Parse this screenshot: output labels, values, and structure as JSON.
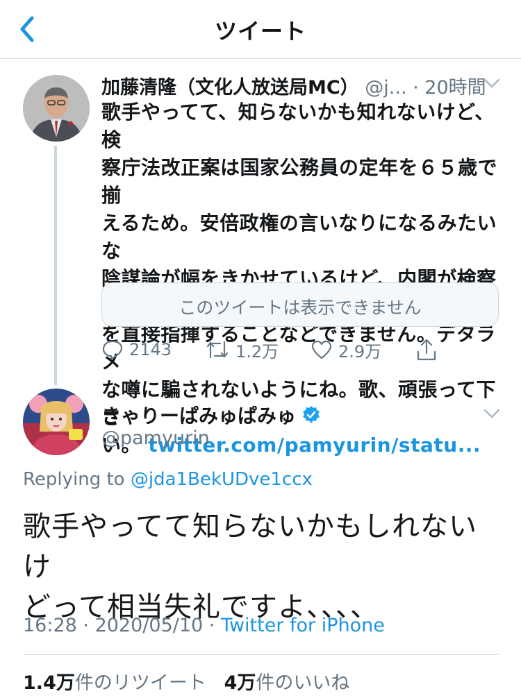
{
  "header": {
    "title": "ツイート"
  },
  "tweet1": {
    "name": "加藤清隆（文化人放送局MC）",
    "handle": "@j...",
    "time": "20時間",
    "text_lines": [
      "歌手やってて、知らないかも知れないけど、検",
      "察庁法改正案は国家公務員の定年を６５歳で揃",
      "えるため。安倍政権の言いなりになるみたいな",
      "陰謀論が幅をきかせているけど、内閣が検察庁",
      "を直接指揮することなどできません。デタラメ",
      "な噂に騙されないようにね。歌、頑張って下さ"
    ],
    "text_last": "い。",
    "link": "twitter.com/pamyurin/statu...",
    "quote_unavailable": "このツイートは表示できません",
    "replies": "2143",
    "retweets": "1.2万",
    "likes": "2.9万"
  },
  "tweet2": {
    "name": "きゃりーぱみゅぱみゅ",
    "handle": "@pamyurin",
    "replying_prefix": "Replying to",
    "replying_to": "@jda1BekUDve1ccx",
    "text_line1": "歌手やってて知らないかもしれないけ",
    "text_line2": "どって相当失礼ですよ、、、、",
    "time": "16:28",
    "date": "2020/05/10",
    "source": "Twitter for iPhone",
    "retweet_count": "1.4万",
    "retweet_label": "件のリツイート",
    "like_count": "4万",
    "like_label": "件のいいね"
  },
  "colors": {
    "accent": "#1b95e0",
    "muted": "#657786",
    "text": "#14171a",
    "verified": "#1da1f2"
  },
  "icons": [
    "back-chevron-icon",
    "chevron-down-icon",
    "reply-icon",
    "retweet-icon",
    "like-icon",
    "share-icon",
    "verified-icon"
  ]
}
